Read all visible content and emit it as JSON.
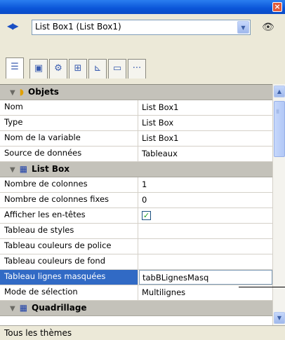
{
  "object_selector": {
    "value": "List Box1 (List Box1)"
  },
  "tabs": [
    {
      "icon": "property-list-icon"
    },
    {
      "icon": "form-object-icon"
    },
    {
      "icon": "gear-icon"
    },
    {
      "icon": "layout-icon"
    },
    {
      "icon": "chart-icon"
    },
    {
      "icon": "monitor-icon"
    },
    {
      "icon": "more-icon",
      "label": "···"
    }
  ],
  "sections": [
    {
      "title": "Objets",
      "rows": [
        {
          "key": "Nom",
          "value": "List Box1"
        },
        {
          "key": "Type",
          "value": "List Box"
        },
        {
          "key": "Nom de la variable",
          "value": "List Box1"
        },
        {
          "key": "Source de données",
          "value": "Tableaux"
        }
      ]
    },
    {
      "title": "List Box",
      "rows": [
        {
          "key": "Nombre de colonnes",
          "value": "1"
        },
        {
          "key": "Nombre de colonnes fixes",
          "value": "0"
        },
        {
          "key": "Afficher les en-têtes",
          "value": "",
          "checked": true
        },
        {
          "key": "Tableau de styles",
          "value": ""
        },
        {
          "key": "Tableau couleurs de police",
          "value": ""
        },
        {
          "key": "Tableau couleurs de fond",
          "value": ""
        },
        {
          "key": "Tableau lignes masquées",
          "value": "tabBLignesMasq",
          "selected": true
        },
        {
          "key": "Mode de sélection",
          "value": "Multilignes"
        }
      ]
    },
    {
      "title": "Quadrillage",
      "rows": []
    }
  ],
  "footer": {
    "text": "Tous les thèmes"
  },
  "colors": {
    "titlebar": "#0a55d8",
    "selection": "#316ac5",
    "section_header": "#c4c2ba"
  }
}
